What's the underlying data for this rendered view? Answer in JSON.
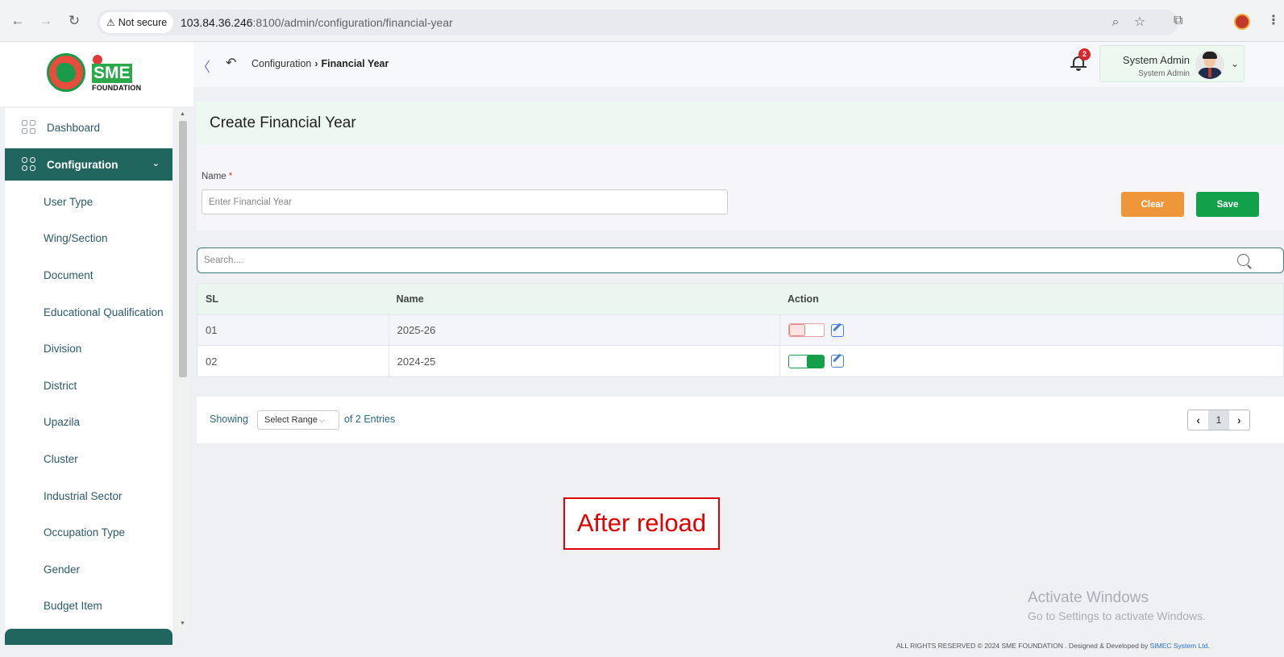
{
  "browser": {
    "security_chip": "Not secure",
    "url_host": "103.84.36.246",
    "url_rest": ":8100/admin/configuration/financial-year"
  },
  "brand": {
    "logo_sme": "SME",
    "logo_foundation": "FOUNDATION"
  },
  "sidebar": {
    "items": [
      {
        "label": "Dashboard",
        "icon": "dashboard-grid-icon"
      },
      {
        "label": "Configuration",
        "icon": "configuration-icon",
        "active": true
      }
    ],
    "sub_items": [
      "User Type",
      "Wing/Section",
      "Document",
      "Educational Qualification",
      "Division",
      "District",
      "Upazila",
      "Cluster",
      "Industrial Sector",
      "Occupation Type",
      "Gender",
      "Budget Item"
    ]
  },
  "topbar": {
    "breadcrumb_parent": "Configuration",
    "breadcrumb_current": "Financial Year",
    "notification_count": "2",
    "user_name": "System Admin",
    "user_role": "System Admin"
  },
  "form": {
    "title": "Create Financial Year",
    "name_label": "Name",
    "required_mark": "*",
    "name_placeholder": "Enter Financial Year",
    "clear_label": "Clear",
    "save_label": "Save"
  },
  "search": {
    "placeholder": "Search...."
  },
  "table": {
    "headers": [
      "SL",
      "Name",
      "Action"
    ],
    "rows": [
      {
        "sl": "01",
        "name": "2025-26",
        "active": false
      },
      {
        "sl": "02",
        "name": "2024-25",
        "active": true
      }
    ]
  },
  "pagination": {
    "showing_label": "Showing",
    "range_select": "Select Range",
    "entries_label": "of 2 Entries",
    "current_page": "1"
  },
  "annotation": "After reload",
  "windows_watermark": {
    "line1": "Activate Windows",
    "line2": "Go to Settings to activate Windows."
  },
  "footer": {
    "copyright": "ALL RIGHTS RESERVED © 2024 SME FOUNDATION . Designed & Developed by ",
    "developer": "SIMEC System Ltd."
  },
  "colors": {
    "primary": "#20665e",
    "save": "#13a04a",
    "clear": "#f0963a",
    "annotation": "#e00000"
  }
}
